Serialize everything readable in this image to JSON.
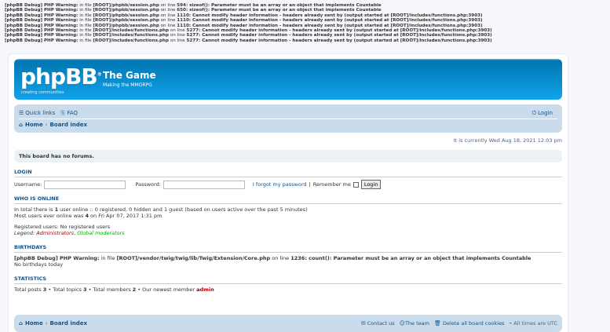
{
  "debug_lines": [
    {
      "prefix": "[phpBB Debug] PHP Warning:",
      "mid": " in file ",
      "file": "[ROOT]/phpbb/session.php",
      "on": " on line ",
      "line": "594",
      "msg": ": sizeof(): Parameter must be an array or an object that implements Countable"
    },
    {
      "prefix": "[phpBB Debug] PHP Warning:",
      "mid": " in file ",
      "file": "[ROOT]/phpbb/session.php",
      "on": " on line ",
      "line": "650",
      "msg": ": sizeof(): Parameter must be an array or an object that implements Countable"
    },
    {
      "prefix": "[phpBB Debug] PHP Warning:",
      "mid": " in file ",
      "file": "[ROOT]/phpbb/session.php",
      "on": " on line ",
      "line": "1110",
      "msg": ": Cannot modify header information - headers already sent by (output started at [ROOT]/includes/functions.php:3903)"
    },
    {
      "prefix": "[phpBB Debug] PHP Warning:",
      "mid": " in file ",
      "file": "[ROOT]/phpbb/session.php",
      "on": " on line ",
      "line": "1110",
      "msg": ": Cannot modify header information - headers already sent by (output started at [ROOT]/includes/functions.php:3903)"
    },
    {
      "prefix": "[phpBB Debug] PHP Warning:",
      "mid": " in file ",
      "file": "[ROOT]/phpbb/session.php",
      "on": " on line ",
      "line": "1110",
      "msg": ": Cannot modify header information - headers already sent by (output started at [ROOT]/includes/functions.php:3903)"
    },
    {
      "prefix": "[phpBB Debug] PHP Warning:",
      "mid": " in file ",
      "file": "[ROOT]/includes/functions.php",
      "on": " on line ",
      "line": "5277",
      "msg": ": Cannot modify header information - headers already sent by (output started at [ROOT]/includes/functions.php:3903)"
    },
    {
      "prefix": "[phpBB Debug] PHP Warning:",
      "mid": " in file ",
      "file": "[ROOT]/includes/functions.php",
      "on": " on line ",
      "line": "5277",
      "msg": ": Cannot modify header information - headers already sent by (output started at [ROOT]/includes/functions.php:3903)"
    },
    {
      "prefix": "[phpBB Debug] PHP Warning:",
      "mid": " in file ",
      "file": "[ROOT]/includes/functions.php",
      "on": " on line ",
      "line": "5277",
      "msg": ": Cannot modify header information - headers already sent by (output started at [ROOT]/includes/functions.php:3903)"
    }
  ],
  "header": {
    "logo": "phpBB",
    "logo_registered": "®",
    "logo_tagline": "creating communities",
    "site_title": "The Game",
    "site_desc": "Making the MMORPG"
  },
  "navbar": {
    "quick_links": "Quick links",
    "faq": "FAQ",
    "login": "Login",
    "home": "Home",
    "board_index": "Board index"
  },
  "current_time": "It is currently Wed Aug 18, 2021 12:03 pm",
  "no_forums": "This board has no forums.",
  "login": {
    "heading": "Login",
    "username_label": "Username:",
    "password_label": "Password:",
    "forgot": "I forgot my password",
    "sep": "|",
    "remember": "Remember me",
    "button": "Login"
  },
  "online": {
    "heading": "Who is online",
    "line1_a": "In total there is ",
    "line1_count": "1",
    "line1_b": " user online :: 0 registered, 0 hidden and 1 guest (based on users active over the past 5 minutes)",
    "line2_a": "Most users ever online was ",
    "line2_count": "4",
    "line2_b": " on Fri Apr 07, 2017 1:31 pm",
    "registered": "Registered users: No registered users",
    "legend_label": "Legend: ",
    "legend_admin": "Administrators",
    "legend_comma": ", ",
    "legend_gmod": "Global moderators"
  },
  "birthdays": {
    "heading": "Birthdays",
    "debug_prefix": "[phpBB Debug] PHP Warning:",
    "debug_mid": " in file ",
    "debug_file": "[ROOT]/vendor/twig/twig/lib/Twig/Extension/Core.php",
    "debug_on": " on line ",
    "debug_line": "1236",
    "debug_msg": ": count(): Parameter must be an array or an object that implements Countable",
    "none": "No birthdays today"
  },
  "stats": {
    "heading": "Statistics",
    "posts_label": "Total posts ",
    "posts": "3",
    "topics_label": " • Total topics ",
    "topics": "3",
    "members_label": " • Total members ",
    "members": "2",
    "newest_label": " • Our newest member ",
    "newest": "admin"
  },
  "footer": {
    "home": "Home",
    "board_index": "Board index",
    "contact": "Contact us",
    "team": "The team",
    "delete_cookies": "Delete all board cookies",
    "timezone": "• All times are UTC"
  },
  "colors": {
    "header_blue": "#12a3eb",
    "navbar": "#cadceb",
    "link": "#105289",
    "admin": "#aa0000",
    "gmod": "#00aa00"
  }
}
